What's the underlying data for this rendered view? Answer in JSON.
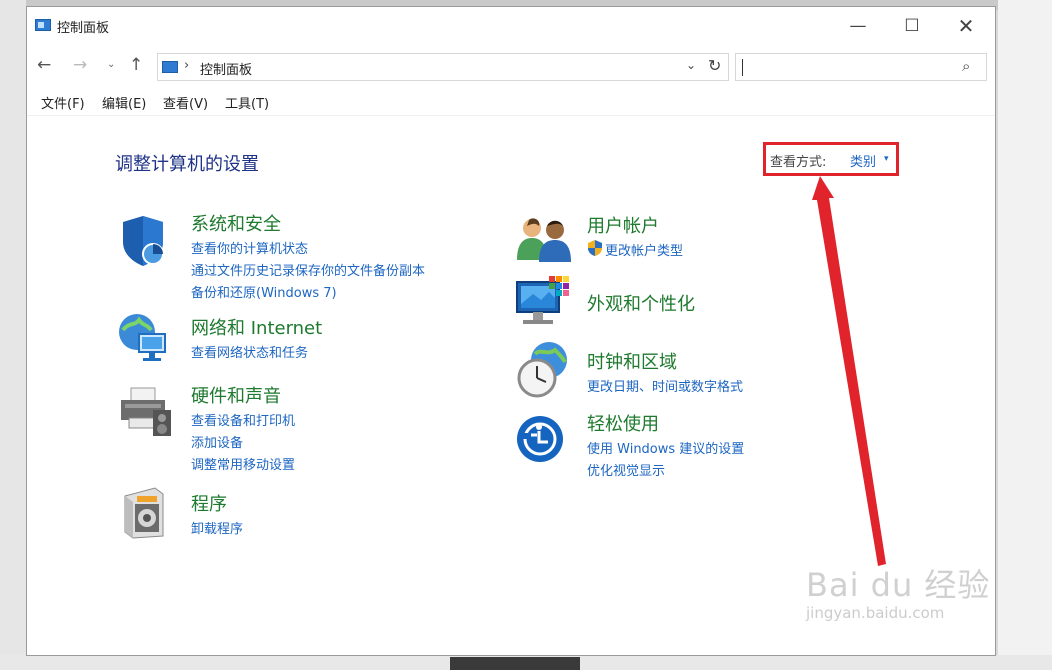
{
  "window": {
    "title": "控制面板"
  },
  "titlebar": {
    "minimize": "—",
    "maximize": "☐",
    "close": "✕"
  },
  "address": {
    "back": "←",
    "forward": "→",
    "history": "⌄",
    "up": "↑",
    "separator": "›",
    "path": "控制面板",
    "dropdown": "⌄",
    "refresh": "↻"
  },
  "search": {
    "placeholder": "",
    "icon": "⌕"
  },
  "menu": {
    "file": "文件(F)",
    "edit": "编辑(E)",
    "view": "查看(V)",
    "tools": "工具(T)"
  },
  "main": {
    "heading": "调整计算机的设置",
    "view_by_label": "查看方式:",
    "view_by_value": "类别",
    "view_by_caret": "▾"
  },
  "categories": {
    "system": {
      "title": "系统和安全",
      "links": [
        "查看你的计算机状态",
        "通过文件历史记录保存你的文件备份副本",
        "备份和还原(Windows 7)"
      ],
      "icon": "shield-icon"
    },
    "network": {
      "title": "网络和 Internet",
      "links": [
        "查看网络状态和任务"
      ],
      "icon": "network-icon"
    },
    "hardware": {
      "title": "硬件和声音",
      "links": [
        "查看设备和打印机",
        "添加设备",
        "调整常用移动设置"
      ],
      "icon": "printer-icon"
    },
    "programs": {
      "title": "程序",
      "links": [
        "卸载程序"
      ],
      "icon": "programs-icon"
    },
    "users": {
      "title": "用户帐户",
      "links": [
        "更改帐户类型"
      ],
      "icon": "users-icon"
    },
    "appearance": {
      "title": "外观和个性化",
      "links": [],
      "icon": "monitor-icon"
    },
    "clock": {
      "title": "时钟和区域",
      "links": [
        "更改日期、时间或数字格式"
      ],
      "icon": "clock-icon"
    },
    "ease": {
      "title": "轻松使用",
      "links": [
        "使用 Windows 建议的设置",
        "优化视觉显示"
      ],
      "icon": "ease-of-access-icon"
    }
  },
  "watermark": {
    "logo": "Bai du 经验",
    "url": "jingyan.baidu.com"
  },
  "colors": {
    "heading": "#1e3287",
    "category": "#1e7a2e",
    "link": "#1d66c2",
    "highlight": "#e1242b"
  }
}
